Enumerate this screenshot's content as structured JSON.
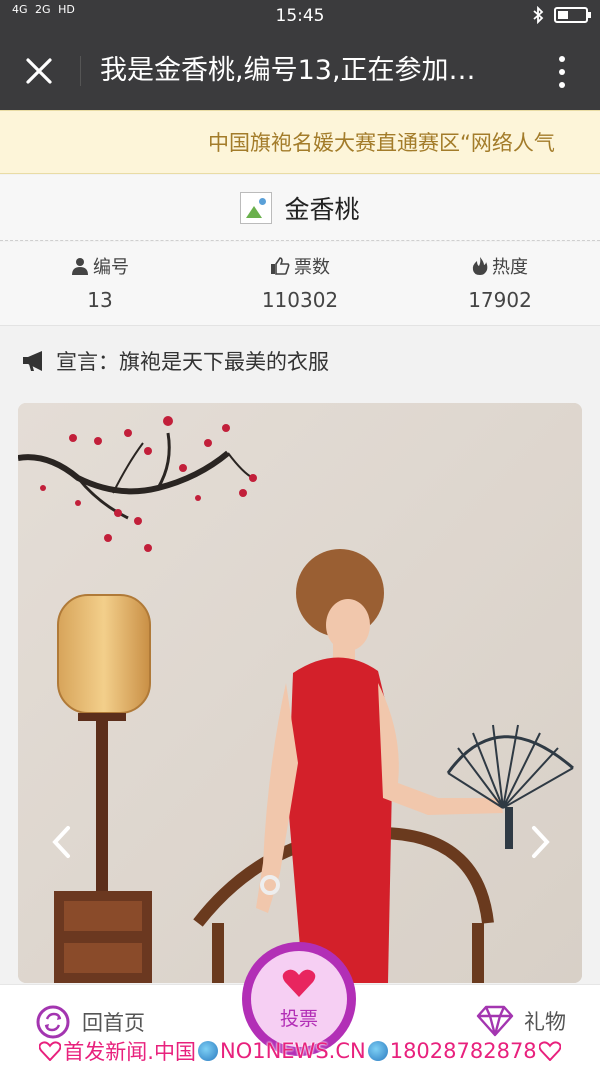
{
  "statusbar": {
    "network_4g": "4G",
    "network_2g": "2G",
    "hd": "HD",
    "time": "15:45"
  },
  "header": {
    "title": "我是金香桃,编号13,正在参加…"
  },
  "marquee": {
    "text": "中国旗袍名媛大赛直通赛区“网络人气"
  },
  "contestant": {
    "name": "金香桃"
  },
  "stats": [
    {
      "label": "编号",
      "value": "13",
      "icon": "user-icon"
    },
    {
      "label": "票数",
      "value": "110302",
      "icon": "thumbs-up-icon"
    },
    {
      "label": "热度",
      "value": "17902",
      "icon": "flame-icon"
    }
  ],
  "declaration": {
    "text": "宣言：旗袍是天下最美的衣服",
    "icon": "megaphone-icon"
  },
  "bottom": {
    "home_label": "回首页",
    "vote_label": "投票",
    "gift_label": "礼物"
  },
  "watermark": {
    "part1": "首发新闻.中国",
    "part2": "NO1NEWS.CN",
    "part3": "18028782878"
  },
  "colors": {
    "header_bg": "#3b3b3d",
    "marquee_bg": "#fdf5d9",
    "marquee_text": "#a37c2a",
    "vote_purple": "#b22fb6",
    "vote_pink": "#f6cff3",
    "watermark": "#e8217d"
  }
}
